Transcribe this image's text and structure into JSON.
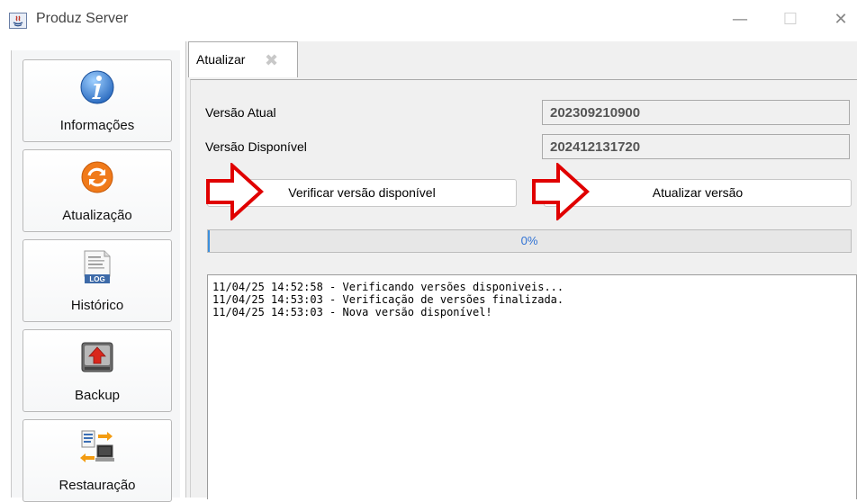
{
  "window": {
    "title": "Produz Server",
    "controls": {
      "minimize": "—",
      "maximize": "☐",
      "close": "✕"
    }
  },
  "sidebar": {
    "items": [
      {
        "label": "Informações",
        "icon": "info-icon"
      },
      {
        "label": "Atualização",
        "icon": "refresh-icon"
      },
      {
        "label": "Histórico",
        "icon": "log-file-icon",
        "icon_text": "LOG"
      },
      {
        "label": "Backup",
        "icon": "backup-drive-icon"
      },
      {
        "label": "Restauração",
        "icon": "restore-transfer-icon"
      }
    ]
  },
  "tab": {
    "label": "Atualizar",
    "close_glyph": "✖"
  },
  "form": {
    "current_version_label": "Versão Atual",
    "current_version_value": "202309210900",
    "available_version_label": "Versão Disponível",
    "available_version_value": "202412131720"
  },
  "buttons": {
    "check_label": "Verificar versão disponível",
    "update_label": "Atualizar versão"
  },
  "progress": {
    "value": 0,
    "text": "0%"
  },
  "log": {
    "lines": [
      "11/04/25 14:52:58 - Verificando versões disponiveis...",
      "11/04/25 14:53:03 - Verificação de versões finalizada.",
      "11/04/25 14:53:03 - Nova versão disponível!"
    ]
  },
  "colors": {
    "arrow_red": "#e00000",
    "progress_blue": "#3c8fdc",
    "progress_text": "#3173d4"
  }
}
